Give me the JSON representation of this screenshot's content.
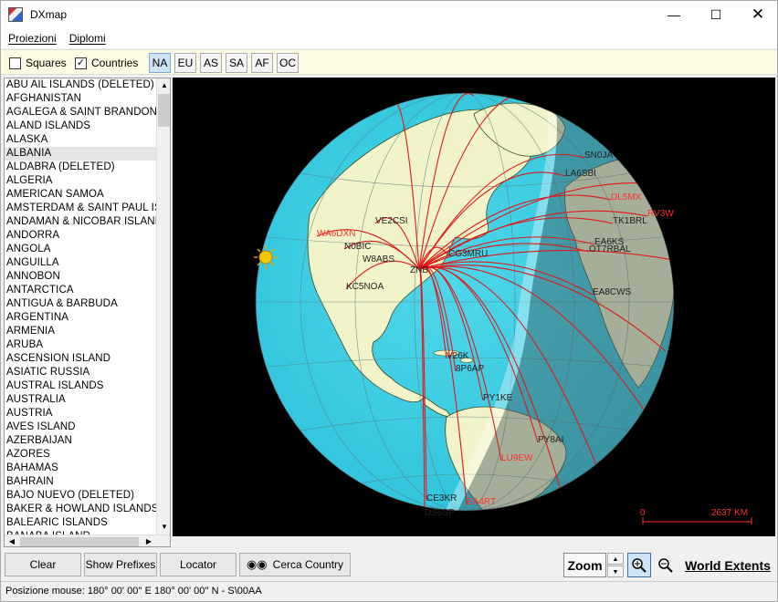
{
  "window": {
    "title": "DXmap"
  },
  "menu": [
    {
      "label": "Proiezioni"
    },
    {
      "label": "Diplomi"
    }
  ],
  "toolbar": {
    "squares": {
      "label": "Squares",
      "checked": false
    },
    "countries": {
      "label": "Countries",
      "checked": true
    },
    "continents": [
      {
        "label": "NA",
        "active": true
      },
      {
        "label": "EU",
        "active": false
      },
      {
        "label": "AS",
        "active": false
      },
      {
        "label": "SA",
        "active": false
      },
      {
        "label": "AF",
        "active": false
      },
      {
        "label": "OC",
        "active": false
      }
    ]
  },
  "countries": [
    "ABU AIL ISLANDS (DELETED)",
    "AFGHANISTAN",
    "AGALEGA & SAINT BRANDON IS",
    "ALAND ISLANDS",
    "ALASKA",
    "ALBANIA",
    "ALDABRA (DELETED)",
    "ALGERIA",
    "AMERICAN SAMOA",
    "AMSTERDAM & SAINT PAUL ISL",
    "ANDAMAN & NICOBAR ISLANDS",
    "ANDORRA",
    "ANGOLA",
    "ANGUILLA",
    "ANNOBON",
    "ANTARCTICA",
    "ANTIGUA & BARBUDA",
    "ARGENTINA",
    "ARMENIA",
    "ARUBA",
    "ASCENSION ISLAND",
    "ASIATIC RUSSIA",
    "AUSTRAL ISLANDS",
    "AUSTRALIA",
    "AUSTRIA",
    "AVES ISLAND",
    "AZERBAIJAN",
    "AZORES",
    "BAHAMAS",
    "BAHRAIN",
    "BAJO NUEVO (DELETED)",
    "BAKER & HOWLAND ISLANDS",
    "BALEARIC ISLANDS",
    "BANABA ISLAND"
  ],
  "selected_country": "ALBANIA",
  "map": {
    "labels": [
      {
        "text": "WA6DXN",
        "color": "#ff3030"
      },
      {
        "text": "VE2CSI",
        "color": "#222"
      },
      {
        "text": "N0BIC",
        "color": "#222"
      },
      {
        "text": "W8ABS",
        "color": "#222"
      },
      {
        "text": "CG3MRU",
        "color": "#222"
      },
      {
        "text": "KC5NOA",
        "color": "#222"
      },
      {
        "text": "ZNB",
        "color": "#222"
      },
      {
        "text": "V26K",
        "color": "#222"
      },
      {
        "text": "8P6AP",
        "color": "#222"
      },
      {
        "text": "PY1KE",
        "color": "#222"
      },
      {
        "text": "PY8AI",
        "color": "#222"
      },
      {
        "text": "LU9EW",
        "color": "#ff3030"
      },
      {
        "text": "CE3KR",
        "color": "#222"
      },
      {
        "text": "EA4RT",
        "color": "#ff3030"
      },
      {
        "text": "DS6SP",
        "color": "#222"
      },
      {
        "text": "EA8CWS",
        "color": "#222"
      },
      {
        "text": "EA6KS",
        "color": "#222"
      },
      {
        "text": "OT7RBAL",
        "color": "#222"
      },
      {
        "text": "SN0JA",
        "color": "#222"
      },
      {
        "text": "LA6SBI",
        "color": "#222"
      },
      {
        "text": "DL5MX",
        "color": "#ff3030"
      },
      {
        "text": "RV3W",
        "color": "#ff3030"
      },
      {
        "text": "TK1BRL",
        "color": "#222"
      }
    ],
    "scale": {
      "start": "0",
      "end": "2637 KM"
    }
  },
  "buttons": {
    "clear": "Clear",
    "show_prefixes": "Show Prefixes",
    "locator": "Locator",
    "cerca": "Cerca Country",
    "zoom": "Zoom",
    "world_extents": "World Extents"
  },
  "status": "Posizione mouse: 180° 00' 00'' E 180° 00' 00'' N - S\\00AA"
}
